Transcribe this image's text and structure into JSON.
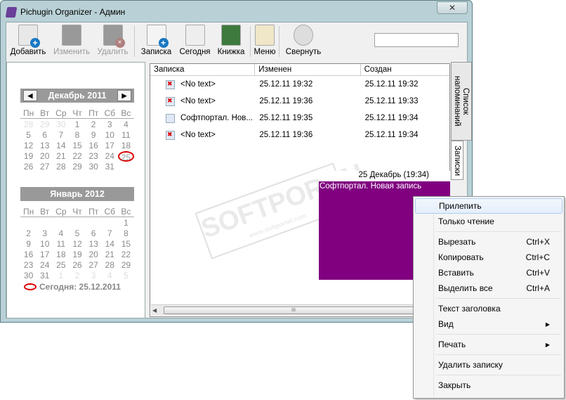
{
  "window": {
    "title": "Pichugin Organizer - Админ",
    "close": "✕"
  },
  "toolbar": [
    {
      "label": "Добавить",
      "icon": "add-note-icon",
      "enabled": true
    },
    {
      "label": "Изменить",
      "icon": "edit-pencil-icon",
      "enabled": false
    },
    {
      "label": "Удалить",
      "icon": "delete-icon",
      "enabled": false
    },
    {
      "sep": true
    },
    {
      "label": "Записка",
      "icon": "sticky-note-icon",
      "enabled": true
    },
    {
      "label": "Сегодня",
      "icon": "calendar-today-icon",
      "enabled": true
    },
    {
      "label": "Книжка",
      "icon": "address-book-icon",
      "enabled": true
    },
    {
      "sep": true
    },
    {
      "label": "Меню",
      "icon": "menu-notepad-icon",
      "enabled": true
    },
    {
      "sep": true
    },
    {
      "label": "Свернуть",
      "icon": "minimize-icon",
      "enabled": true
    }
  ],
  "search": {
    "value": ""
  },
  "calendar": {
    "daynames": [
      "Пн",
      "Вт",
      "Ср",
      "Чт",
      "Пт",
      "Сб",
      "Вс"
    ],
    "months": [
      {
        "title": "Декабрь 2011",
        "prev": "◀",
        "next": "▶",
        "days": [
          [
            "28",
            "o"
          ],
          [
            "29",
            "o"
          ],
          [
            "30",
            "o"
          ],
          [
            "1"
          ],
          [
            "2"
          ],
          [
            "3"
          ],
          [
            "4"
          ],
          [
            "5"
          ],
          [
            "6"
          ],
          [
            "7"
          ],
          [
            "8"
          ],
          [
            "9"
          ],
          [
            "10"
          ],
          [
            "11"
          ],
          [
            "12"
          ],
          [
            "13"
          ],
          [
            "14"
          ],
          [
            "15"
          ],
          [
            "16"
          ],
          [
            "17"
          ],
          [
            "18"
          ],
          [
            "19"
          ],
          [
            "20"
          ],
          [
            "21"
          ],
          [
            "22"
          ],
          [
            "23"
          ],
          [
            "24"
          ],
          [
            "25",
            "t"
          ],
          [
            "26"
          ],
          [
            "27"
          ],
          [
            "28"
          ],
          [
            "29"
          ],
          [
            "30"
          ],
          [
            "31"
          ]
        ]
      },
      {
        "title": "Январь 2012",
        "days": [
          [
            ""
          ],
          [
            ""
          ],
          [
            ""
          ],
          [
            ""
          ],
          [
            ""
          ],
          [
            ""
          ],
          [
            "1"
          ],
          [
            "2"
          ],
          [
            "3"
          ],
          [
            "4"
          ],
          [
            "5"
          ],
          [
            "6"
          ],
          [
            "7"
          ],
          [
            "8"
          ],
          [
            "9"
          ],
          [
            "10"
          ],
          [
            "11"
          ],
          [
            "12"
          ],
          [
            "13"
          ],
          [
            "14"
          ],
          [
            "15"
          ],
          [
            "16"
          ],
          [
            "17"
          ],
          [
            "18"
          ],
          [
            "19"
          ],
          [
            "20"
          ],
          [
            "21"
          ],
          [
            "22"
          ],
          [
            "23"
          ],
          [
            "24"
          ],
          [
            "25"
          ],
          [
            "26"
          ],
          [
            "27"
          ],
          [
            "28"
          ],
          [
            "29"
          ],
          [
            "30"
          ],
          [
            "31"
          ],
          [
            "1",
            "o"
          ],
          [
            "2",
            "o"
          ],
          [
            "3",
            "o"
          ],
          [
            "4",
            "o"
          ],
          [
            "5",
            "o"
          ]
        ]
      }
    ],
    "today": "Сегодня: 25.12.2011"
  },
  "notes": {
    "columns": [
      "Записка",
      "Изменен",
      "Создан"
    ],
    "rows": [
      {
        "text": "<No text>",
        "changed": "25.12.11 19:32",
        "created": "25.12.11 19:32",
        "icon": "empty-note-icon"
      },
      {
        "text": "<No text>",
        "changed": "25.12.11 19:36",
        "created": "25.12.11 19:33",
        "icon": "empty-note-icon"
      },
      {
        "text": "Софтпортал. Нов...",
        "changed": "25.12.11 19:35",
        "created": "25.12.11 19:34",
        "icon": "note-icon"
      },
      {
        "text": "<No text>",
        "changed": "25.12.11 19:36",
        "created": "25.12.11 19:34",
        "icon": "empty-note-icon"
      }
    ],
    "scroll_grip": "III"
  },
  "tabs": [
    {
      "label": "Список напоминаний"
    },
    {
      "label": "Записки",
      "active": true
    }
  ],
  "sticky": {
    "title": "25 Декабрь (19:34)",
    "text": "Софтпортал. Новая запись",
    "color": "#800080"
  },
  "watermark": {
    "text": "SOFTPORTAL",
    "url": "www.softportal.com"
  },
  "context_menu": [
    {
      "label": "Прилепить",
      "highlighted": true
    },
    {
      "label": "Только чтение"
    },
    {
      "sep": true
    },
    {
      "label": "Вырезать",
      "shortcut": "Ctrl+X"
    },
    {
      "label": "Копировать",
      "shortcut": "Ctrl+C"
    },
    {
      "label": "Вставить",
      "shortcut": "Ctrl+V"
    },
    {
      "label": "Выделить все",
      "shortcut": "Ctrl+A"
    },
    {
      "sep": true
    },
    {
      "label": "Текст заголовка"
    },
    {
      "label": "Вид",
      "submenu": true
    },
    {
      "sep": true
    },
    {
      "label": "Печать",
      "submenu": true
    },
    {
      "sep": true
    },
    {
      "label": "Удалить записку"
    },
    {
      "sep": true
    },
    {
      "label": "Закрыть"
    }
  ]
}
